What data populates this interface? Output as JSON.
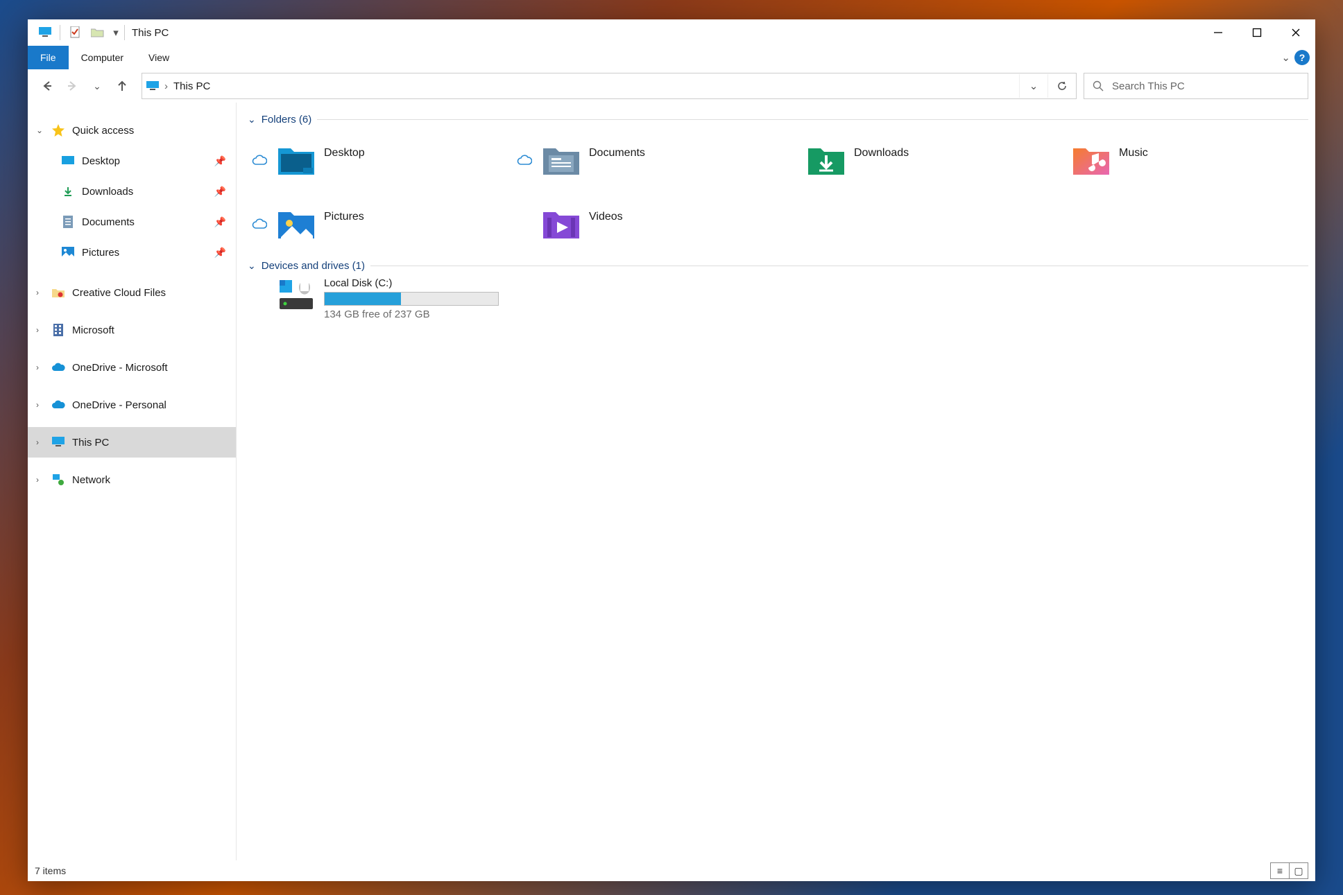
{
  "title_bar": {
    "title": "This PC"
  },
  "ribbon": {
    "file": "File",
    "tabs": [
      "Computer",
      "View"
    ]
  },
  "address": {
    "crumb": "This PC"
  },
  "search": {
    "placeholder": "Search This PC"
  },
  "sidebar": {
    "quick_access": "Quick access",
    "items": [
      {
        "label": "Desktop",
        "pinned": true
      },
      {
        "label": "Downloads",
        "pinned": true
      },
      {
        "label": "Documents",
        "pinned": true
      },
      {
        "label": "Pictures",
        "pinned": true
      }
    ],
    "roots": [
      {
        "label": "Creative Cloud Files"
      },
      {
        "label": "Microsoft"
      },
      {
        "label": "OneDrive - Microsoft"
      },
      {
        "label": "OneDrive - Personal"
      },
      {
        "label": "This PC"
      },
      {
        "label": "Network"
      }
    ]
  },
  "groups": {
    "folders_header": "Folders (6)",
    "folders": [
      {
        "label": "Desktop",
        "sync": true
      },
      {
        "label": "Documents",
        "sync": true
      },
      {
        "label": "Downloads",
        "sync": false
      },
      {
        "label": "Music",
        "sync": false
      },
      {
        "label": "Pictures",
        "sync": true
      },
      {
        "label": "Videos",
        "sync": false
      }
    ],
    "drives_header": "Devices and drives (1)",
    "drive": {
      "label": "Local Disk (C:)",
      "free_text": "134 GB free of 237 GB",
      "fill_percent": 44
    }
  },
  "status": {
    "text": "7 items"
  }
}
